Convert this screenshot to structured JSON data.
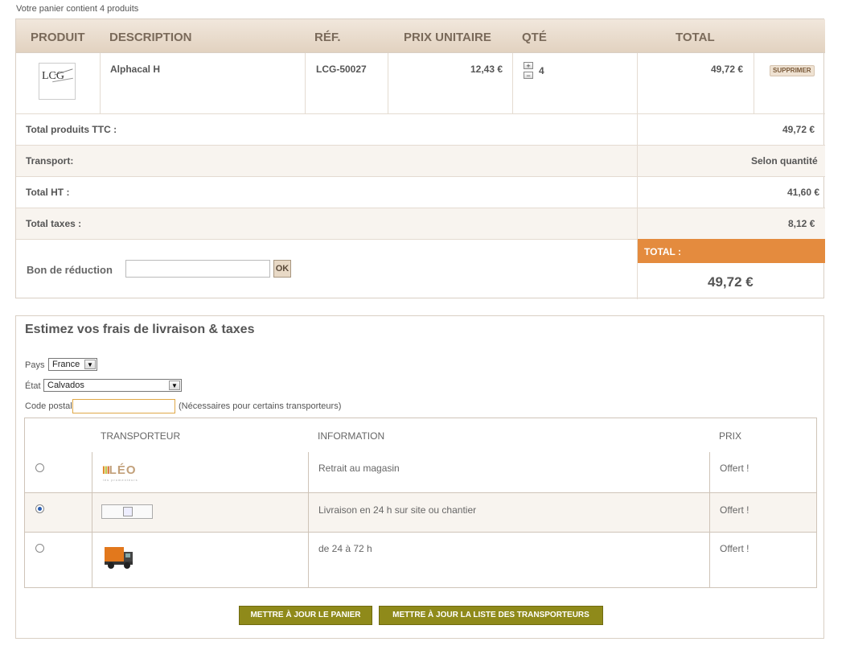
{
  "cart": {
    "summary": "Votre panier contient 4 produits",
    "headers": {
      "product": "PRODUIT",
      "description": "DESCRIPTION",
      "ref": "RÉF.",
      "unit_price": "PRIX UNITAIRE",
      "qty": "QTÉ",
      "total": "TOTAL"
    },
    "items": [
      {
        "name": "Alphacal H",
        "ref": "LCG-50027",
        "unit_price": "12,43 €",
        "qty": "4",
        "total": "49,72 €",
        "delete_label": "SUPPRIMER",
        "qty_plus": "+",
        "qty_minus": "−",
        "thumb_logo": "LCG"
      }
    ],
    "totals": [
      {
        "label": "Total produits TTC :",
        "value": "49,72 €"
      },
      {
        "label": "Transport:",
        "value": "Selon quantité"
      },
      {
        "label": "Total HT :",
        "value": "41,60 €"
      },
      {
        "label": "Total taxes :",
        "value": "8,12 €"
      }
    ],
    "coupon": {
      "label": "Bon de réduction",
      "value": "",
      "ok_label": "OK"
    },
    "grand_total": {
      "label": "TOTAL :",
      "value": "49,72 €"
    }
  },
  "estimate": {
    "title": "Estimez vos frais de livraison & taxes",
    "country_label": "Pays",
    "country_value": "France",
    "state_label": "État",
    "state_value": "Calvados",
    "postal_label": "Code postal",
    "postal_value": "",
    "postal_note": "(Nécessaires pour certains transporteurs)",
    "columns": {
      "carrier": "TRANSPORTEUR",
      "info": "INFORMATION",
      "price": "PRIX"
    },
    "carriers": [
      {
        "logo": "LÉO",
        "logo_sub": "les promenteurs",
        "info": "Retrait au magasin",
        "price": "Offert !",
        "selected": false
      },
      {
        "logo": "",
        "info": "Livraison en 24 h sur site ou chantier",
        "price": "Offert !",
        "selected": true
      },
      {
        "logo": "truck",
        "info": "de 24 à 72 h",
        "price": "Offert !",
        "selected": false
      }
    ]
  },
  "buttons": {
    "update_cart": "METTRE À JOUR LE PANIER",
    "update_carriers": "METTRE À JOUR LA LISTE DES TRANSPORTEURS"
  },
  "colors": {
    "accent": "#e48b3e",
    "button": "#8f8a1a",
    "header_bg": "#e8dccd"
  }
}
